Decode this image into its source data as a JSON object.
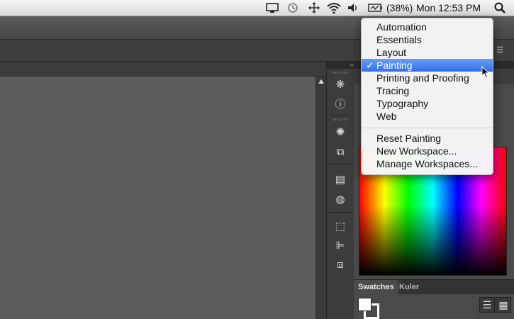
{
  "menubar": {
    "battery": "(38%)",
    "clock": "Mon 12:53 PM"
  },
  "workspace_menu": {
    "items": [
      "Automation",
      "Essentials",
      "Layout",
      "Painting",
      "Printing and Proofing",
      "Tracing",
      "Typography",
      "Web"
    ],
    "selected": "Painting",
    "check": "✓",
    "actions": [
      "Reset Painting",
      "New Workspace...",
      "Manage Workspaces..."
    ]
  },
  "panel": {
    "tabs": [
      "Swatches",
      "Kuler"
    ]
  },
  "colors": {
    "menu_highlight": "#2f6fe6",
    "app_bg": "#323232",
    "canvas": "#5c5c5c"
  }
}
